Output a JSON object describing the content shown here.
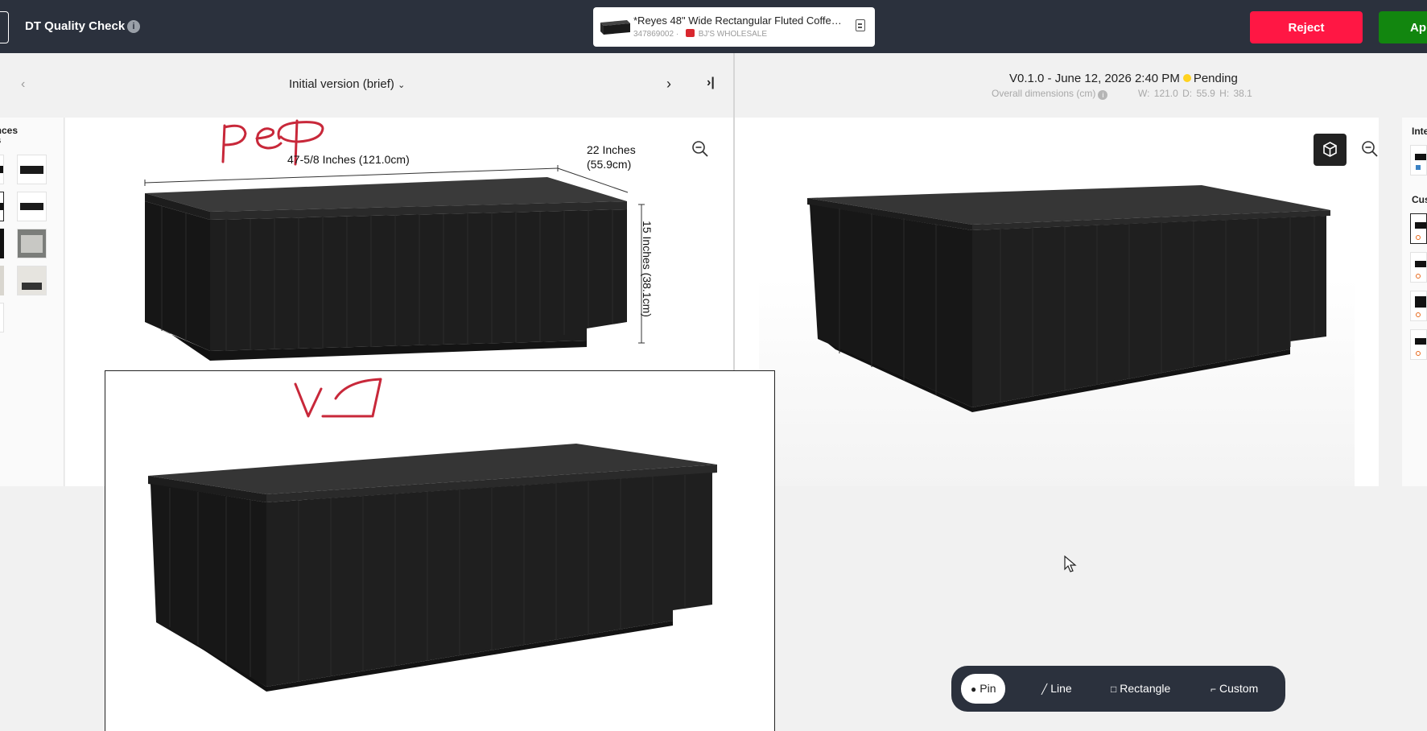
{
  "header": {
    "app_title": "DT Quality Check",
    "info_icon": "info-icon",
    "product": {
      "name": "*Reyes 48\" Wide Rectangular Fluted Coffee ...",
      "sku": "347869002",
      "separator": "·",
      "retailer": "BJ'S WHOLESALE"
    },
    "reject_label": "Reject",
    "approve_label": "Ap"
  },
  "left_panel": {
    "version_label": "Initial version (brief)",
    "prev_icon": "chevron-left-icon",
    "next_icon": "chevron-right-icon",
    "last_icon": "skip-to-last-icon",
    "sidebar_title_line1": "ences",
    "sidebar_title_line2": "es",
    "dimensions": {
      "width": "47-5/8 Inches (121.0cm)",
      "depth_line1": "22 Inches",
      "depth_line2": "(55.9cm)",
      "height": "15 Inches (38.1cm)"
    },
    "annotation_ref": "реф",
    "annotation_v1": "V1"
  },
  "right_panel": {
    "version_title": "V0.1.0 - June 12, 2026 2:40 PM",
    "status": "Pending",
    "status_color": "#ffd21f",
    "dims_label": "Overall dimensions (cm)",
    "dims_values": "W: 121.0   D: 55.9   H: 38.1",
    "sidebar_label_1": "Inte",
    "sidebar_label_2": "Cus"
  },
  "toolbar": {
    "tools": [
      {
        "label": "Pin",
        "icon": "pin-icon",
        "active": true
      },
      {
        "label": "Line",
        "icon": "line-icon",
        "active": false
      },
      {
        "label": "Rectangle",
        "icon": "rectangle-icon",
        "active": false
      },
      {
        "label": "Custom",
        "icon": "custom-shape-icon",
        "active": false
      }
    ]
  },
  "colors": {
    "topbar": "#2b313d",
    "reject": "#ff1744",
    "approve": "#12860f",
    "annotation": "#c8283a"
  }
}
